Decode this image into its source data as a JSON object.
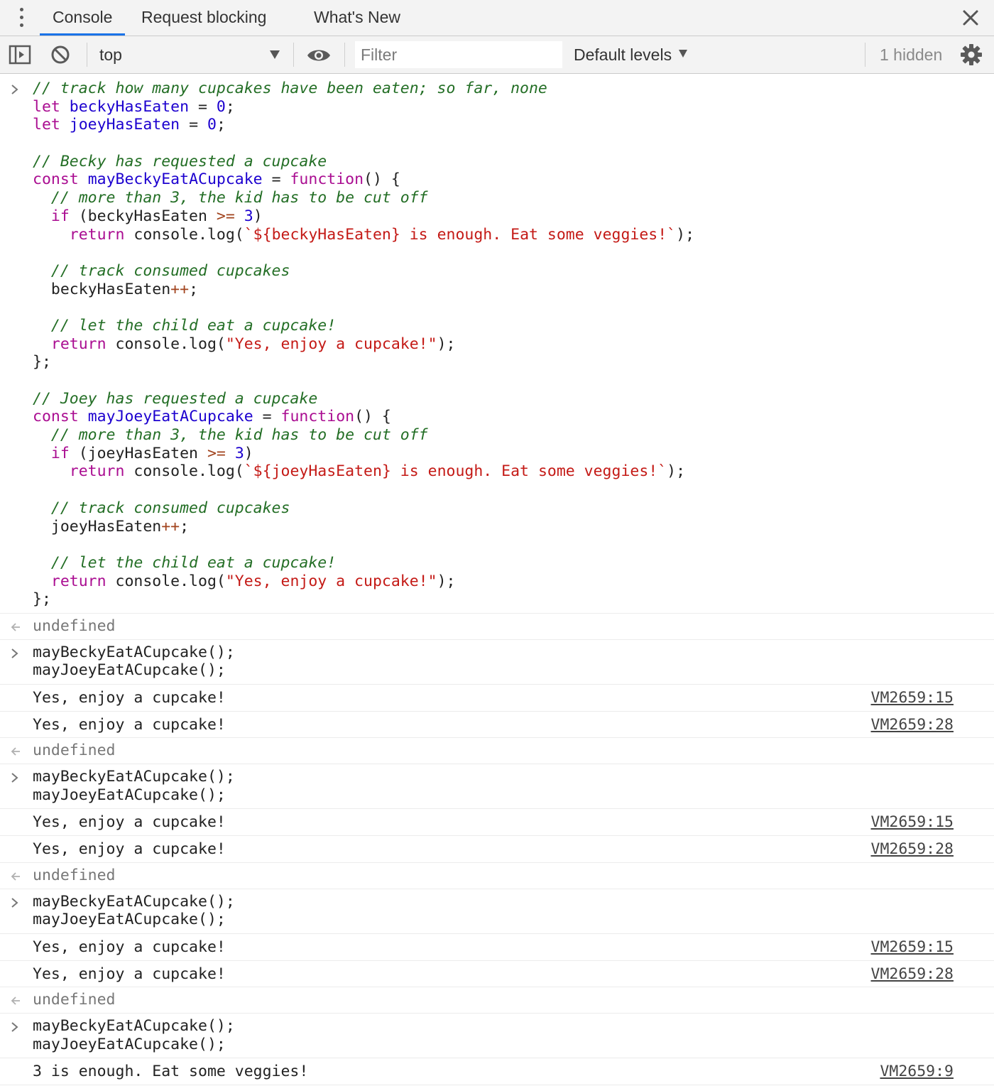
{
  "tabs": [
    {
      "label": "Console",
      "active": true
    },
    {
      "label": "Request blocking",
      "active": false
    },
    {
      "label": "What's New",
      "active": false
    }
  ],
  "toolbar": {
    "context": "top",
    "filter_placeholder": "Filter",
    "levels_label": "Default levels",
    "hidden_count": "1 hidden"
  },
  "code": {
    "c_track": "// track how many cupcakes have been eaten; so far, none",
    "kw_let": "let",
    "v_becky": "beckyHasEaten",
    "v_joey": "joeyHasEaten",
    "eq": " = ",
    "zero": "0",
    "semi": ";",
    "c_becky_req": "// Becky has requested a cupcake",
    "c_joey_req": "// Joey has requested a cupcake",
    "kw_const": "const",
    "f_becky": "mayBeckyEatACupcake",
    "f_joey": "mayJoeyEatACupcake",
    "kw_function": "function",
    "fn_tail": "() {",
    "c_more": "// more than 3, the kid has to be cut off",
    "kw_if": "if",
    "if_open": " (",
    "op_gte": ">=",
    "three": "3",
    "close_paren": ")",
    "kw_return": "return",
    "console_log_open": " console.log(",
    "tpl_becky_expr": "`${beckyHasEaten}",
    "tpl_joey_expr": "`${joeyHasEaten}",
    "tpl_rest": " is enough. Eat some veggies!`",
    "call_close": ");",
    "c_consumed": "// track consumed cupcakes",
    "op_inc": "++",
    "c_let_eat": "// let the child eat a cupcake!",
    "str_yes": "\"Yes, enjoy a cupcake!\"",
    "block_close": "};"
  },
  "console": {
    "undefined": "undefined",
    "call_becky": "mayBeckyEatACupcake();",
    "call_joey": "mayJoeyEatACupcake();",
    "yes_msg": "Yes, enjoy a cupcake!",
    "enough_msg": "3 is enough. Eat some veggies!",
    "src_15": "VM2659:15",
    "src_28": "VM2659:28",
    "src_9": "VM2659:9"
  }
}
